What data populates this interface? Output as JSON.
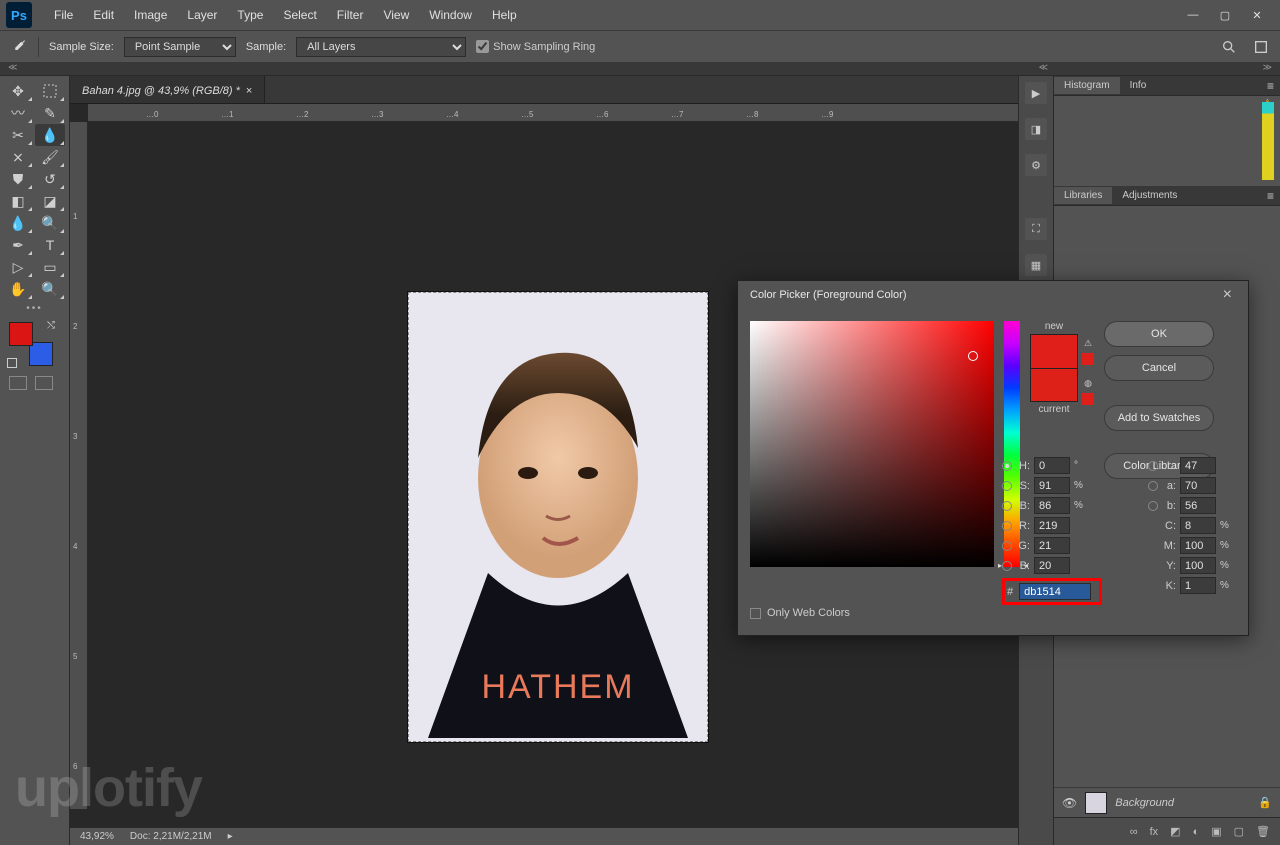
{
  "menubar": [
    "File",
    "Edit",
    "Image",
    "Layer",
    "Type",
    "Select",
    "Filter",
    "View",
    "Window",
    "Help"
  ],
  "optionsBar": {
    "sampleSizeLabel": "Sample Size:",
    "sampleSizeValue": "Point Sample",
    "sampleLabel": "Sample:",
    "sampleValue": "All Layers",
    "showSamplingRing": "Show Sampling Ring"
  },
  "document": {
    "tabTitle": "Bahan 4.jpg @ 43,9% (RGB/8) *",
    "zoom": "43,92%",
    "docSize": "Doc: 2,21M/2,21M"
  },
  "rulersH": [
    "…0",
    "…1",
    "…2",
    "…3",
    "…4",
    "…5",
    "…6",
    "…7",
    "…8",
    "…9"
  ],
  "rulersV": [
    "1",
    "2",
    "3",
    "4",
    "5",
    "6"
  ],
  "panels": {
    "histogramTabs": [
      "Histogram",
      "Info"
    ],
    "libraryTabs": [
      "Libraries",
      "Adjustments"
    ],
    "layerName": "Background"
  },
  "colorPicker": {
    "title": "Color Picker (Foreground Color)",
    "newLabel": "new",
    "currentLabel": "current",
    "ok": "OK",
    "cancel": "Cancel",
    "addToSwatches": "Add to Swatches",
    "colorLibraries": "Color Libraries",
    "onlyWebColors": "Only Web Colors",
    "H": "0",
    "S": "91",
    "B": "86",
    "R": "219",
    "G": "21",
    "Bb": "20",
    "L": "47",
    "a": "70",
    "b": "56",
    "C": "8",
    "M": "100",
    "Y": "100",
    "K": "1",
    "hex": "db1514"
  },
  "watermark": "uplotify"
}
